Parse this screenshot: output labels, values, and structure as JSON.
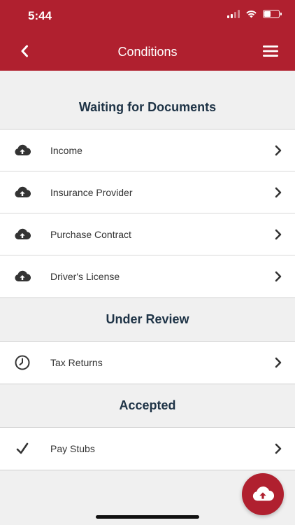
{
  "status_bar": {
    "time": "5:44"
  },
  "nav": {
    "title": "Conditions"
  },
  "sections": [
    {
      "title": "Waiting for Documents",
      "items": [
        {
          "label": "Income",
          "icon": "cloud-upload-icon"
        },
        {
          "label": "Insurance Provider",
          "icon": "cloud-upload-icon"
        },
        {
          "label": "Purchase Contract",
          "icon": "cloud-upload-icon"
        },
        {
          "label": "Driver's License",
          "icon": "cloud-upload-icon"
        }
      ]
    },
    {
      "title": "Under Review",
      "items": [
        {
          "label": "Tax Returns",
          "icon": "clock-icon"
        }
      ]
    },
    {
      "title": "Accepted",
      "items": [
        {
          "label": "Pay Stubs",
          "icon": "checkmark-icon"
        }
      ]
    }
  ],
  "colors": {
    "brand": "#b0202f",
    "heading": "#1e3346",
    "background": "#f0f0f0"
  }
}
